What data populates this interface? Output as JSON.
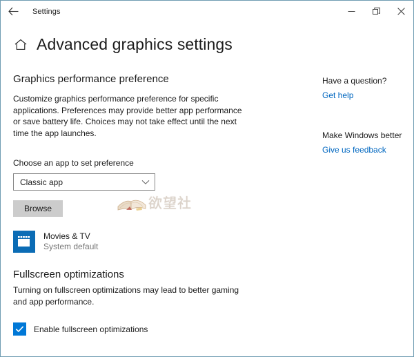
{
  "window": {
    "titlebar_title": "Settings",
    "back_icon": "back-arrow-icon",
    "minimize_icon": "minimize-icon",
    "restore_icon": "restore-icon",
    "close_icon": "close-icon",
    "border_color": "#6f9cb2"
  },
  "header": {
    "home_icon": "home-icon",
    "title": "Advanced graphics settings"
  },
  "main": {
    "section_heading": "Graphics performance preference",
    "section_description": "Customize graphics performance preference for specific applications. Preferences may provide better app performance or save battery life. Choices may not take effect until the next time the app launches.",
    "field_label": "Choose an app to set preference",
    "dropdown": {
      "value": "Classic app",
      "chevron_icon": "chevron-down-icon"
    },
    "browse_label": "Browse",
    "app_entry": {
      "icon": "movies-tv-icon",
      "icon_color": "#0b6cb5",
      "name": "Movies & TV",
      "subtitle": "System default"
    }
  },
  "watermark": {
    "icon": "open-book-icon",
    "text": "欲望社"
  },
  "fullscreen": {
    "heading": "Fullscreen optimizations",
    "description": "Turning on fullscreen optimizations may lead to better gaming and app performance.",
    "checkbox": {
      "label": "Enable fullscreen optimizations",
      "checked": true,
      "accent_color": "#0078d7",
      "check_icon": "checkmark-icon"
    }
  },
  "sidebar": {
    "blocks": [
      {
        "heading": "Have a question?",
        "link": "Get help"
      },
      {
        "heading": "Make Windows better",
        "link": "Give us feedback"
      }
    ],
    "link_color": "#0067c0"
  }
}
